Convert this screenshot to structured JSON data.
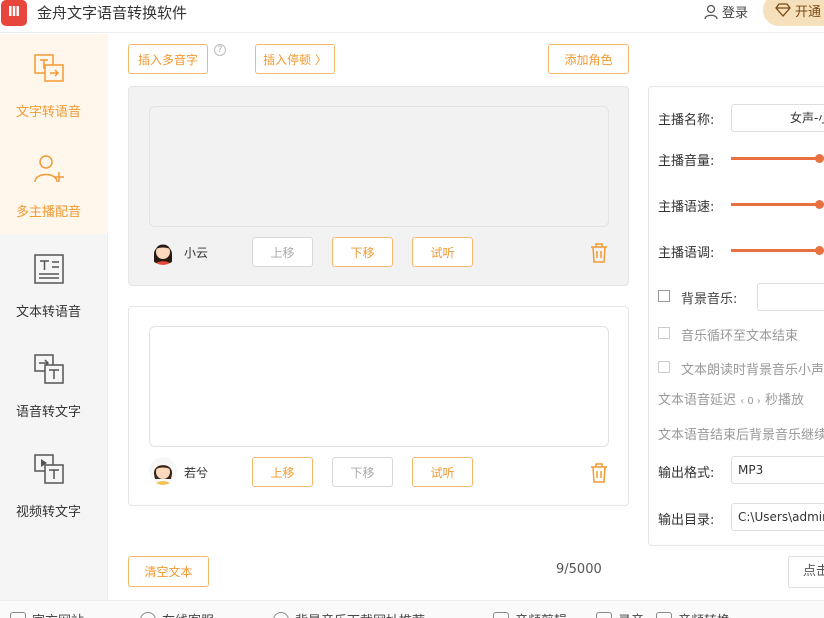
{
  "app": {
    "title": "金舟文字语音转换软件",
    "logo_text": "Ⅲ"
  },
  "header": {
    "login_label": "登录",
    "vip_label": "开通"
  },
  "sidebar": {
    "items": [
      {
        "label": "文字转语音",
        "icon": "text-to-speech-icon",
        "active": true
      },
      {
        "label": "多主播配音",
        "icon": "multi-speaker-icon",
        "active": true
      },
      {
        "label": "文本转语音",
        "icon": "document-icon",
        "active": false
      },
      {
        "label": "语音转文字",
        "icon": "speech-to-text-icon",
        "active": false
      },
      {
        "label": "视频转文字",
        "icon": "video-to-text-icon",
        "active": false
      }
    ]
  },
  "toolbar": {
    "insert_polyphone": "插入多音字",
    "help": "?",
    "insert_pause": "插入停顿 〉",
    "add_role": "添加角色"
  },
  "cards": [
    {
      "voice_name": "小云",
      "move_up": "上移",
      "move_down": "下移",
      "listen": "试听",
      "text": ""
    },
    {
      "voice_name": "若兮",
      "move_up": "上移",
      "move_down": "下移",
      "listen": "试听",
      "text": ""
    }
  ],
  "footer": {
    "clear_text": "清空文本",
    "counter": "9/5000"
  },
  "settings": {
    "anchor_name_label": "主播名称:",
    "anchor_name_value": "女声-小",
    "volume_label": "主播音量:",
    "volume": 0.8,
    "speed_label": "主播语速:",
    "speed": 0.8,
    "pitch_label": "主播语调:",
    "pitch": 0.8,
    "bg_music_label": "背景音乐:",
    "loop_label": "音乐循环至文本结束",
    "lower_label": "文本朗读时背景音乐小声",
    "delay_prefix": "文本语音延迟",
    "delay_value": "‹ 0 ›",
    "delay_suffix": "秒播放",
    "after_end_label": "文本语音结束后背景音乐继续",
    "format_label": "输出格式:",
    "format_value": "MP3",
    "dir_label": "输出目录:",
    "dir_value": "C:\\Users\\admin",
    "convert_button": "点击"
  },
  "bottom": {
    "items": [
      {
        "label": "官方网站",
        "icon": "home-icon"
      },
      {
        "label": "在线客服",
        "icon": "headset-icon"
      },
      {
        "label": "背景音乐下载网址推荐",
        "icon": "music-icon"
      },
      {
        "label": "音频剪辑",
        "icon": "scissors-icon"
      },
      {
        "label": "录音",
        "icon": "mic-icon"
      },
      {
        "label": "音频转换",
        "icon": "convert-icon"
      }
    ]
  },
  "colors": {
    "accent": "#f29a33",
    "slider": "#e8713f",
    "sidebar_bg": "#f5f5f5"
  }
}
